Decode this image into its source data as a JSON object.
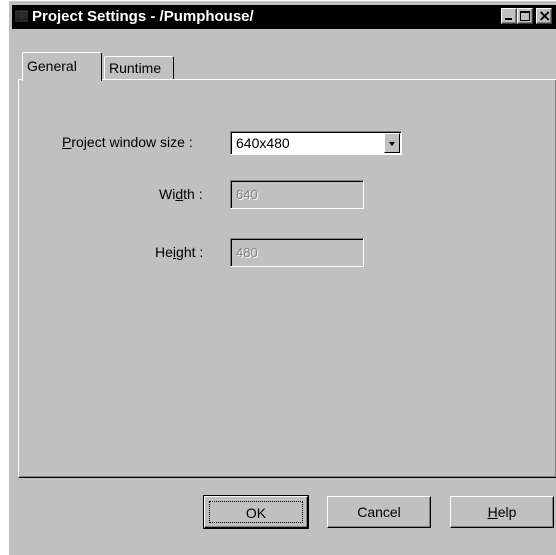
{
  "window": {
    "title": "Project Settings - /Pumphouse/",
    "icon": "app-icon"
  },
  "tabs": [
    {
      "label": "General",
      "selected": true
    },
    {
      "label": "Runtime",
      "selected": false
    }
  ],
  "general": {
    "size": {
      "label_prefix": "",
      "label_u": "P",
      "label_rest": "roject window size :",
      "value": "640x480"
    },
    "width": {
      "label_pre": "Wi",
      "label_u": "d",
      "label_post": "th :",
      "value": "640"
    },
    "height": {
      "label_pre": "He",
      "label_u": "i",
      "label_post": "ght :",
      "value": "480"
    }
  },
  "buttons": {
    "ok": "OK",
    "cancel": "Cancel",
    "help_u": "H",
    "help_rest": "elp"
  }
}
